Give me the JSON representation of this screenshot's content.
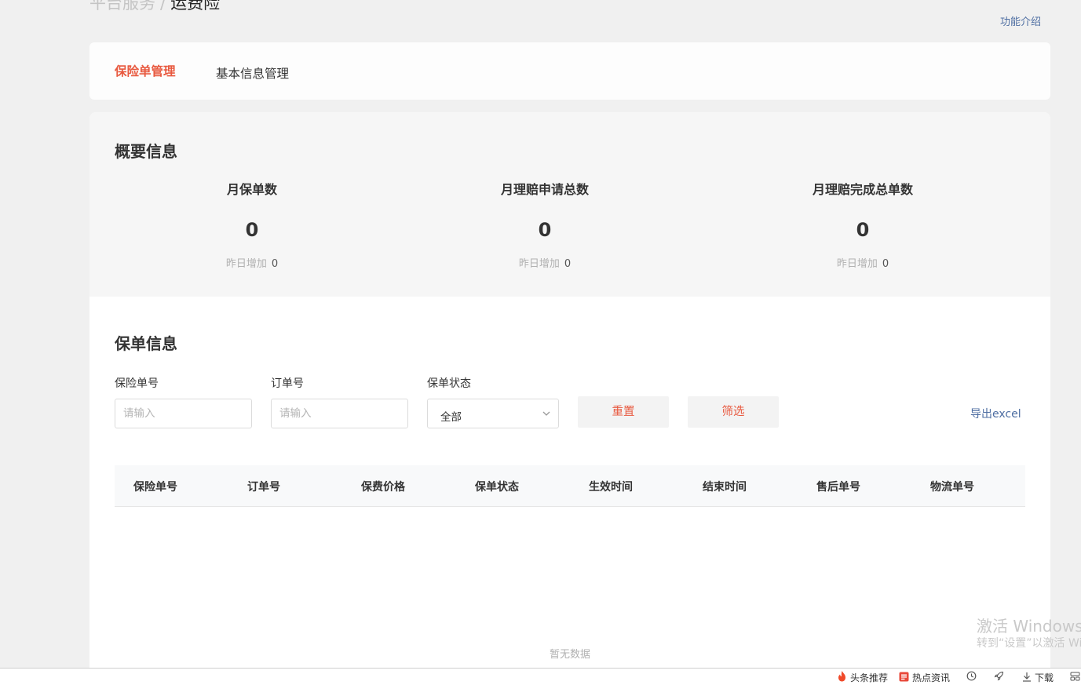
{
  "breadcrumb": {
    "parent": "平台服务",
    "separator": "/",
    "current": "运费险"
  },
  "header": {
    "feature_link": "功能介绍"
  },
  "tabs": [
    {
      "label": "保险单管理",
      "active": true
    },
    {
      "label": "基本信息管理",
      "active": false
    }
  ],
  "overview": {
    "title": "概要信息",
    "stats": [
      {
        "label": "月保单数",
        "value": "0",
        "sub_label": "昨日增加",
        "sub_value": "0"
      },
      {
        "label": "月理赔申请总数",
        "value": "0",
        "sub_label": "昨日增加",
        "sub_value": "0"
      },
      {
        "label": "月理赔完成总单数",
        "value": "0",
        "sub_label": "昨日增加",
        "sub_value": "0"
      }
    ]
  },
  "policy": {
    "title": "保单信息",
    "filters": {
      "policy_no_label": "保险单号",
      "policy_no_placeholder": "请输入",
      "order_no_label": "订单号",
      "order_no_placeholder": "请输入",
      "status_label": "保单状态",
      "status_value": "全部"
    },
    "buttons": {
      "reset": "重置",
      "filter": "筛选",
      "export": "导出excel"
    },
    "table": {
      "columns": [
        "保险单号",
        "订单号",
        "保费价格",
        "保单状态",
        "生效时间",
        "结束时间",
        "售后单号",
        "物流单号"
      ],
      "empty_text": "暂无数据"
    }
  },
  "watermark": {
    "title": "激活 Windows",
    "subtitle": "转到“设置”以激活 Windows。"
  },
  "taskbar": {
    "news_label": "头条推荐",
    "hot_label": "热点资讯",
    "download_label": "下载"
  },
  "colors": {
    "accent": "#e8593f",
    "link": "#4e6ea2",
    "page_bg": "#f0f0f0",
    "overview_bg": "#f6f6f6"
  }
}
